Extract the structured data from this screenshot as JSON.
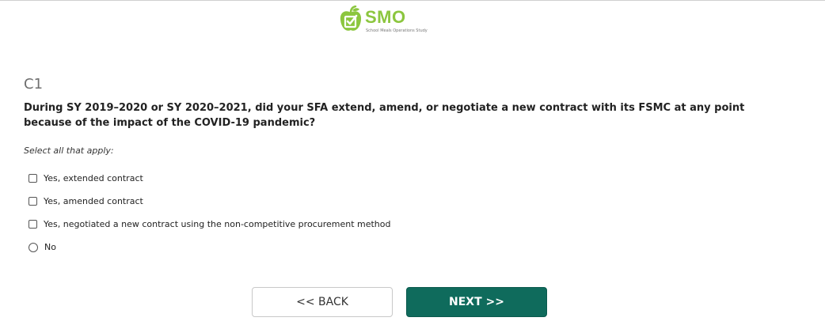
{
  "brand": {
    "name": "SMO",
    "subtitle": "School Meals Operations Study",
    "icon": "apple-checkbox-icon",
    "color": "#8cc63f"
  },
  "question": {
    "id": "C1",
    "text": "During SY 2019–2020 or SY 2020–2021, did your SFA extend, amend, or negotiate a new contract with its FSMC at any point because of the impact of the COVID-19 pandemic?",
    "instruction": "Select all that apply:",
    "options": [
      {
        "label": "Yes, extended contract",
        "type": "checkbox",
        "checked": false
      },
      {
        "label": "Yes, amended contract",
        "type": "checkbox",
        "checked": false
      },
      {
        "label": "Yes, negotiated a new contract using the non-competitive procurement method",
        "type": "checkbox",
        "checked": false
      },
      {
        "label": "No",
        "type": "radio",
        "checked": false
      }
    ]
  },
  "nav": {
    "back_label": "<< BACK",
    "next_label": "NEXT >>",
    "accent_color": "#0f6b5c"
  }
}
